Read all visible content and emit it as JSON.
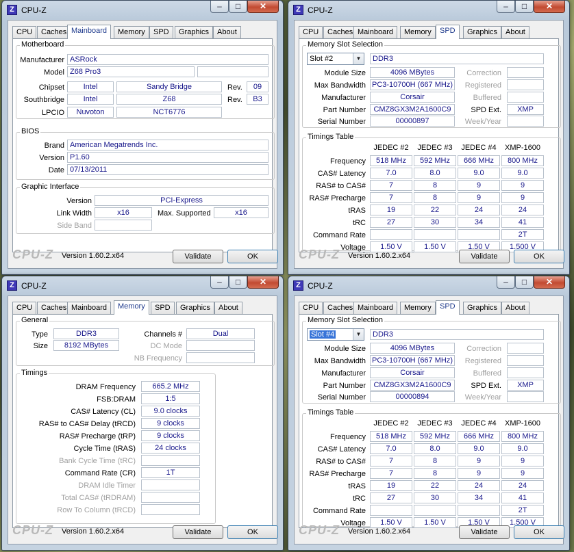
{
  "app": {
    "title": "CPU-Z",
    "icon_letter": "Z",
    "logo": "CPU-Z",
    "version": "Version 1.60.2.x64",
    "validate": "Validate",
    "ok": "OK",
    "minimize": "‒",
    "maximize": "□",
    "close": "✕",
    "tabs": [
      "CPU",
      "Caches",
      "Mainboard",
      "Memory",
      "SPD",
      "Graphics",
      "About"
    ]
  },
  "mainboard": {
    "motherboard": {
      "group": "Motherboard",
      "manufacturer_label": "Manufacturer",
      "manufacturer": "ASRock",
      "model_label": "Model",
      "model": "Z68 Pro3",
      "chipset_label": "Chipset",
      "chipset_vendor": "Intel",
      "chipset_name": "Sandy Bridge",
      "rev_label": "Rev.",
      "chipset_rev": "09",
      "southbridge_label": "Southbridge",
      "sb_vendor": "Intel",
      "sb_name": "Z68",
      "sb_rev": "B3",
      "lpcio_label": "LPCIO",
      "lpcio_vendor": "Nuvoton",
      "lpcio_name": "NCT6776"
    },
    "bios": {
      "group": "BIOS",
      "brand_label": "Brand",
      "brand": "American Megatrends Inc.",
      "version_label": "Version",
      "version": "P1.60",
      "date_label": "Date",
      "date": "07/13/2011"
    },
    "graphic": {
      "group": "Graphic Interface",
      "version_label": "Version",
      "version": "PCI-Express",
      "link_width_label": "Link Width",
      "link_width": "x16",
      "max_supported_label": "Max. Supported",
      "max_supported": "x16",
      "side_band_label": "Side Band"
    }
  },
  "memory": {
    "general": {
      "group": "General",
      "type_label": "Type",
      "type": "DDR3",
      "size_label": "Size",
      "size": "8192 MBytes",
      "channels_label": "Channels #",
      "channels": "Dual",
      "dc_mode_label": "DC Mode",
      "nb_freq_label": "NB Frequency"
    },
    "timings": {
      "group": "Timings",
      "rows": [
        {
          "label": "DRAM Frequency",
          "value": "665.2 MHz",
          "enabled": true
        },
        {
          "label": "FSB:DRAM",
          "value": "1:5",
          "enabled": true
        },
        {
          "label": "CAS# Latency (CL)",
          "value": "9.0 clocks",
          "enabled": true
        },
        {
          "label": "RAS# to CAS# Delay (tRCD)",
          "value": "9 clocks",
          "enabled": true
        },
        {
          "label": "RAS# Precharge (tRP)",
          "value": "9 clocks",
          "enabled": true
        },
        {
          "label": "Cycle Time (tRAS)",
          "value": "24 clocks",
          "enabled": true
        },
        {
          "label": "Bank Cycle Time (tRC)",
          "value": "",
          "enabled": false
        },
        {
          "label": "Command Rate (CR)",
          "value": "1T",
          "enabled": true
        },
        {
          "label": "DRAM Idle Timer",
          "value": "",
          "enabled": false
        },
        {
          "label": "Total CAS# (tRDRAM)",
          "value": "",
          "enabled": false
        },
        {
          "label": "Row To Column (tRCD)",
          "value": "",
          "enabled": false
        }
      ]
    }
  },
  "spd_labels": {
    "slot_group": "Memory Slot Selection",
    "module_size": "Module Size",
    "max_bandwidth": "Max Bandwidth",
    "manufacturer": "Manufacturer",
    "part_number": "Part Number",
    "serial_number": "Serial Number",
    "correction": "Correction",
    "registered": "Registered",
    "buffered": "Buffered",
    "spd_ext": "SPD Ext.",
    "week_year": "Week/Year",
    "timings_group": "Timings Table",
    "columns": [
      "JEDEC #2",
      "JEDEC #3",
      "JEDEC #4",
      "XMP-1600"
    ],
    "rows": [
      "Frequency",
      "CAS# Latency",
      "RAS# to CAS#",
      "RAS# Precharge",
      "tRAS",
      "tRC",
      "Command Rate",
      "Voltage"
    ]
  },
  "spd_slot2": {
    "slot": "Slot #2",
    "type": "DDR3",
    "module_size": "4096 MBytes",
    "max_bandwidth": "PC3-10700H (667 MHz)",
    "manufacturer": "Corsair",
    "part_number": "CMZ8GX3M2A1600C9",
    "serial_number": "00000897",
    "spd_ext": "XMP",
    "table": [
      [
        "518 MHz",
        "592 MHz",
        "666 MHz",
        "800 MHz"
      ],
      [
        "7.0",
        "8.0",
        "9.0",
        "9.0"
      ],
      [
        "7",
        "8",
        "9",
        "9"
      ],
      [
        "7",
        "8",
        "9",
        "9"
      ],
      [
        "19",
        "22",
        "24",
        "24"
      ],
      [
        "27",
        "30",
        "34",
        "41"
      ],
      [
        "",
        "",
        "",
        "2T"
      ],
      [
        "1.50 V",
        "1.50 V",
        "1.50 V",
        "1.500 V"
      ]
    ]
  },
  "spd_slot4": {
    "slot": "Slot #4",
    "type": "DDR3",
    "module_size": "4096 MBytes",
    "max_bandwidth": "PC3-10700H (667 MHz)",
    "manufacturer": "Corsair",
    "part_number": "CMZ8GX3M2A1600C9",
    "serial_number": "00000894",
    "spd_ext": "XMP",
    "table": [
      [
        "518 MHz",
        "592 MHz",
        "666 MHz",
        "800 MHz"
      ],
      [
        "7.0",
        "8.0",
        "9.0",
        "9.0"
      ],
      [
        "7",
        "8",
        "9",
        "9"
      ],
      [
        "7",
        "8",
        "9",
        "9"
      ],
      [
        "19",
        "22",
        "24",
        "24"
      ],
      [
        "27",
        "30",
        "34",
        "41"
      ],
      [
        "",
        "",
        "",
        "2T"
      ],
      [
        "1.50 V",
        "1.50 V",
        "1.50 V",
        "1.500 V"
      ]
    ]
  }
}
